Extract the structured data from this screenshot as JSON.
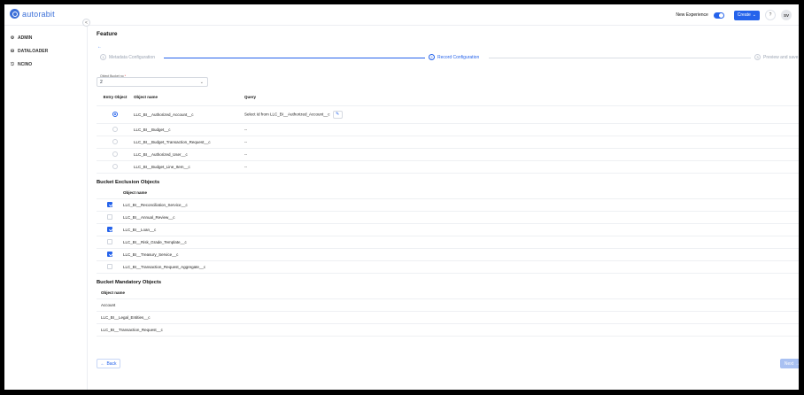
{
  "header": {
    "logo_text": "autorabit",
    "new_experience_label": "New Experience",
    "create_label": "Create",
    "help_label": "?",
    "avatar_initials": "SV"
  },
  "sidebar": {
    "collapse_icon": "<",
    "items": [
      {
        "label": "ADMIN",
        "icon": "gear-icon"
      },
      {
        "label": "DATALOADER",
        "icon": "database-icon"
      },
      {
        "label": "NCINO",
        "icon": "link-icon"
      }
    ]
  },
  "page": {
    "title": "Feature",
    "steps": [
      {
        "num": "1",
        "label": "Metadata Configuration"
      },
      {
        "num": "2",
        "label": "Record Configuration"
      },
      {
        "num": "3",
        "label": "Preview and save"
      }
    ],
    "object_bucket_label": "Object Bucket no",
    "object_bucket_required": "*",
    "object_bucket_value": "2"
  },
  "entry_table": {
    "headers": [
      "Entry Object",
      "Object name",
      "Query"
    ],
    "rows": [
      {
        "name": "LLC_BI__Authorized_Account__c",
        "query": "Select Id from LLC_BI__Authorized_Account__c",
        "selected": true
      },
      {
        "name": "LLC_BI__Budget__c",
        "query": "--",
        "selected": false
      },
      {
        "name": "LLC_BI__Budget_Transaction_Request__c",
        "query": "--",
        "selected": false
      },
      {
        "name": "LLC_BI__Authorized_User__c",
        "query": "--",
        "selected": false
      },
      {
        "name": "LLC_BI__Budget_Line_Item__c",
        "query": "--",
        "selected": false
      }
    ]
  },
  "exclusion": {
    "title": "Bucket Exclusion Objects",
    "header": "Object name",
    "rows": [
      {
        "name": "LLC_BI__Reconciliation_Service__c",
        "checked": true
      },
      {
        "name": "LLC_BI__Annual_Review__c",
        "checked": false
      },
      {
        "name": "LLC_BI__Loan__c",
        "checked": true
      },
      {
        "name": "LLC_BI__Risk_Grade_Template__c",
        "checked": false
      },
      {
        "name": "LLC_BI__Treasury_Service__c",
        "checked": true
      },
      {
        "name": "LLC_BI__Transaction_Request_Aggregate__c",
        "checked": false
      }
    ]
  },
  "mandatory": {
    "title": "Bucket Mandatory Objects",
    "header": "Object name",
    "rows": [
      "Account",
      "LLC_BI__Legal_Entities__c",
      "LLC_BI__Transaction_Request__c"
    ]
  },
  "footer": {
    "back_label": "Back",
    "next_label": "Next"
  },
  "colors": {
    "accent": "#2563eb",
    "next_disabled": "#a9c1f2"
  }
}
